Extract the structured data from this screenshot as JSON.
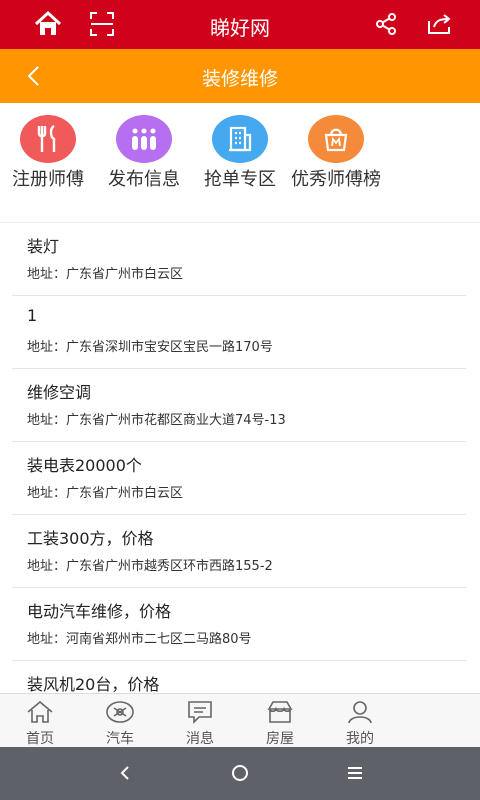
{
  "header": {
    "title": "睇好网"
  },
  "subheader": {
    "title": "装修维修"
  },
  "categories": [
    {
      "label": "注册师傅",
      "color": "#f05a5b",
      "icon": "fork-knife-icon"
    },
    {
      "label": "发布信息",
      "color": "#b56ff0",
      "icon": "bottles-icon"
    },
    {
      "label": "抢单专区",
      "color": "#46a9f0",
      "icon": "building-icon"
    },
    {
      "label": "优秀师傅榜",
      "color": "#f58a3a",
      "icon": "bag-icon"
    }
  ],
  "listings": [
    {
      "title": "装灯",
      "address": "地址：广东省广州市白云区"
    },
    {
      "title": "1",
      "address": "地址：广东省深圳市宝安区宝民一路170号"
    },
    {
      "title": "维修空调",
      "address": "地址：广东省广州市花都区商业大道74号-13"
    },
    {
      "title": "装电表20000个",
      "address": "地址：广东省广州市白云区"
    },
    {
      "title": "工装300方，价格",
      "address": "地址：广东省广州市越秀区环市西路155-2"
    },
    {
      "title": "电动汽车维修，价格",
      "address": "地址：河南省郑州市二七区二马路80号"
    },
    {
      "title": "装风机20台，价格",
      "address": ""
    }
  ],
  "bottom_nav": [
    {
      "label": "首页",
      "icon": "home-icon"
    },
    {
      "label": "汽车",
      "icon": "car-icon"
    },
    {
      "label": "消息",
      "icon": "message-icon"
    },
    {
      "label": "房屋",
      "icon": "house-icon"
    },
    {
      "label": "我的",
      "icon": "user-icon"
    }
  ],
  "colors": {
    "header": "#d0021b",
    "subheader": "#ff9500",
    "system_bar": "#5e6268"
  }
}
